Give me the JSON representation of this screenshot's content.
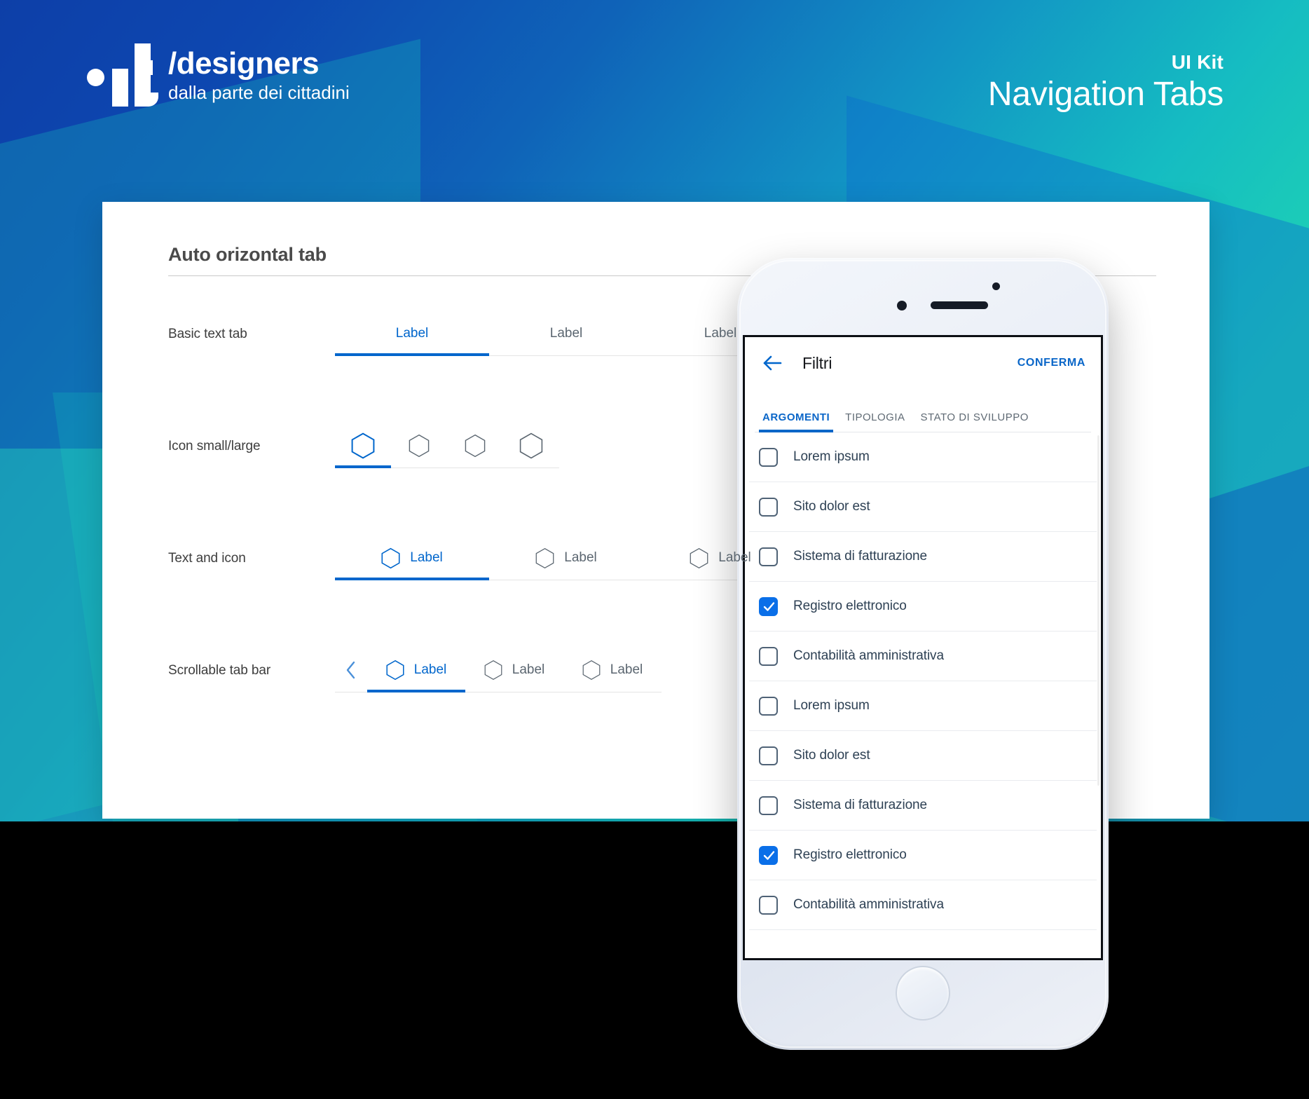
{
  "header": {
    "brand_title": "/designers",
    "brand_subtitle": "dalla parte dei cittadini",
    "brand_logo_name": "it-logo",
    "kit_eyebrow": "UI Kit",
    "kit_title": "Navigation Tabs"
  },
  "colors": {
    "accent_blue": "#0066cc",
    "accent_blue_dark": "#0a66c8",
    "checkbox_blue": "#0a6fe8",
    "gradient_start": "#0d3fa8",
    "gradient_end": "#22ddb0",
    "inactive_text": "#5b6670"
  },
  "card": {
    "section_title": "Auto orizontal tab",
    "rows": [
      {
        "label": "Basic text tab",
        "type": "text",
        "tabs": [
          {
            "label": "Label",
            "active": true
          },
          {
            "label": "Label",
            "active": false
          },
          {
            "label": "Label",
            "active": false
          }
        ]
      },
      {
        "label": "Icon small/large",
        "type": "icon",
        "icon_name": "hexagon-icon",
        "tabs": [
          {
            "label": "",
            "active": true
          },
          {
            "label": "",
            "active": false
          },
          {
            "label": "",
            "active": false
          },
          {
            "label": "",
            "active": false
          }
        ]
      },
      {
        "label": "Text and icon",
        "type": "text-icon",
        "icon_name": "hexagon-icon",
        "tabs": [
          {
            "label": "Label",
            "active": true
          },
          {
            "label": "Label",
            "active": false
          },
          {
            "label": "Label",
            "active": false
          }
        ]
      },
      {
        "label": "Scrollable tab bar",
        "type": "scrollable",
        "icon_name": "hexagon-icon",
        "scroll_prev_icon": "chevron-left-icon",
        "tabs": [
          {
            "label": "Label",
            "active": true
          },
          {
            "label": "Label",
            "active": false
          },
          {
            "label": "Label",
            "active": false
          }
        ]
      }
    ]
  },
  "phone": {
    "app": {
      "back_icon": "arrow-left-icon",
      "title": "Filtri",
      "confirm_label": "CONFERMA",
      "tabs": [
        {
          "label": "ARGOMENTI",
          "active": true
        },
        {
          "label": "TIPOLOGIA",
          "active": false
        },
        {
          "label": "STATO DI SVILUPPO",
          "active": false
        }
      ],
      "filters": [
        {
          "label": "Lorem ipsum",
          "checked": false
        },
        {
          "label": "Sito dolor est",
          "checked": false
        },
        {
          "label": "Sistema di fatturazione",
          "checked": false
        },
        {
          "label": "Registro elettronico",
          "checked": true
        },
        {
          "label": "Contabilità amministrativa",
          "checked": false
        },
        {
          "label": "Lorem ipsum",
          "checked": false
        },
        {
          "label": "Sito dolor est",
          "checked": false
        },
        {
          "label": "Sistema di fatturazione",
          "checked": false
        },
        {
          "label": "Registro elettronico",
          "checked": true
        },
        {
          "label": "Contabilità amministrativa",
          "checked": false
        }
      ]
    }
  }
}
